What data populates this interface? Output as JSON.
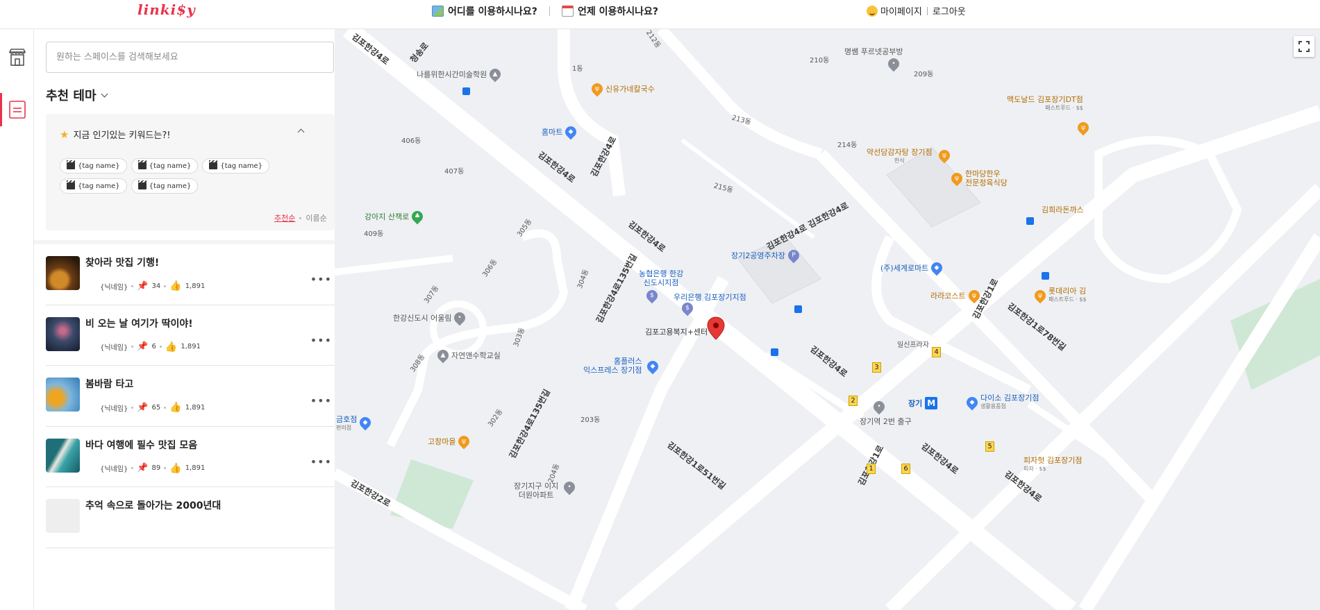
{
  "header": {
    "logo": "linki$y",
    "where_label": "어디를 이용하시나요?",
    "when_label": "언제 이용하시나요?",
    "mypage": "마이페이지",
    "logout": "로그아웃"
  },
  "sidebar": {
    "search_placeholder": "원하는 스페이스를 검색해보세요",
    "theme_title": "추천 테마",
    "popular": {
      "title": "지금 인기있는 키워드는?!",
      "tags": [
        "{tag name}",
        "{tag name}",
        "{tag name}",
        "{tag name}",
        "{tag name}"
      ]
    },
    "sort": {
      "recommended": "추천순",
      "name": "이름순"
    },
    "items": [
      {
        "title": "찾아라 맛집 기행!",
        "nickname": "{닉네임}",
        "pins": "34",
        "likes": "1,891"
      },
      {
        "title": "비 오는 날 여기가 딱이야!",
        "nickname": "{닉네임}",
        "pins": "6",
        "likes": "1,891"
      },
      {
        "title": "봄바람 타고",
        "nickname": "{닉네임}",
        "pins": "65",
        "likes": "1,891"
      },
      {
        "title": "바다 여행에 필수 맛집 모음",
        "nickname": "{닉네임}",
        "pins": "89",
        "likes": "1,891"
      },
      {
        "title": "추억 속으로 돌아가는 2000년대",
        "nickname": "",
        "pins": "",
        "likes": ""
      }
    ]
  },
  "map": {
    "roads": {
      "r1": "김포한강4로",
      "r2": "김포한강4로",
      "r3": "김포한강4로",
      "r4": "김포한강4로 김포한강4로",
      "r5": "김포한강4로",
      "r6": "김포한강4로135번길",
      "r7": "김포한강4로135번길",
      "r8": "김포한강1로51번길",
      "r9": "김포한강1로",
      "r10": "김포한강1로78번길",
      "r11": "김포한강1로",
      "r12": "김포한강4로",
      "r13": "청송로",
      "r14": "김포한강4로",
      "r15": "김포한강2로",
      "r16": "김포한강4로"
    },
    "pois": {
      "art_academy": "나를위한시간미술학원",
      "noodle": "신유가네칼국수",
      "homemart": "홈마트",
      "gangaji": "강아지 산책로",
      "eoullim": "한강신도시 어울림",
      "nature_class": "자연앤수학교실",
      "homeplus1": "홈플러스",
      "homeplus2": "익스프레스 장기점",
      "nonghyup1": "농협은행 한강",
      "nonghyup2": "신도시지점",
      "woori": "우리은행 김포장기지점",
      "welfare": "김포고용복지+센터",
      "parking": "장기2공영주차장",
      "semart": "(주)세계로마트",
      "rarakos": "라라코스트",
      "lotteria1": "롯데리아 김",
      "lotteria2": "패스트푸드 · $$",
      "mcd1": "맥도날드 김포장기DT점",
      "mcd2": "패스트푸드 · $$",
      "myeongssem": "명쌤 푸르넷공부방",
      "yakseon": "약선당감자탕 장기점",
      "yakseon_sub": "한식",
      "hanmadang1": "한마당한우",
      "hanmadang2": "전문정육식당",
      "kimhira": "김희라돈까스",
      "daiso1": "다이소 김포장기점",
      "daiso2": "생활용품점",
      "station": "장기",
      "exit2": "장기역 2번 출구",
      "pizza1": "피자헛 김포장기점",
      "pizza2": "피자 · $$",
      "gochang": "고창마을",
      "geumho1": "금호점",
      "geumho2": "편의점",
      "ezi1": "장기지구 이지",
      "ezi2": "더원아파트",
      "ilsin": "일신프라자"
    },
    "buildings": [
      "406동",
      "407동",
      "409동",
      "305동",
      "306동",
      "307동",
      "304동",
      "303동",
      "308동",
      "302동",
      "203동",
      "204동",
      "210동",
      "209동",
      "213동",
      "214동",
      "215동",
      "212동",
      "1동"
    ],
    "exits": [
      "1",
      "2",
      "3",
      "4",
      "5",
      "6"
    ],
    "colors": {
      "marker": "#e53935",
      "food": "#f19a1d",
      "shop": "#4285f4",
      "park": "#34a853",
      "transit": "#1a73e8"
    }
  }
}
